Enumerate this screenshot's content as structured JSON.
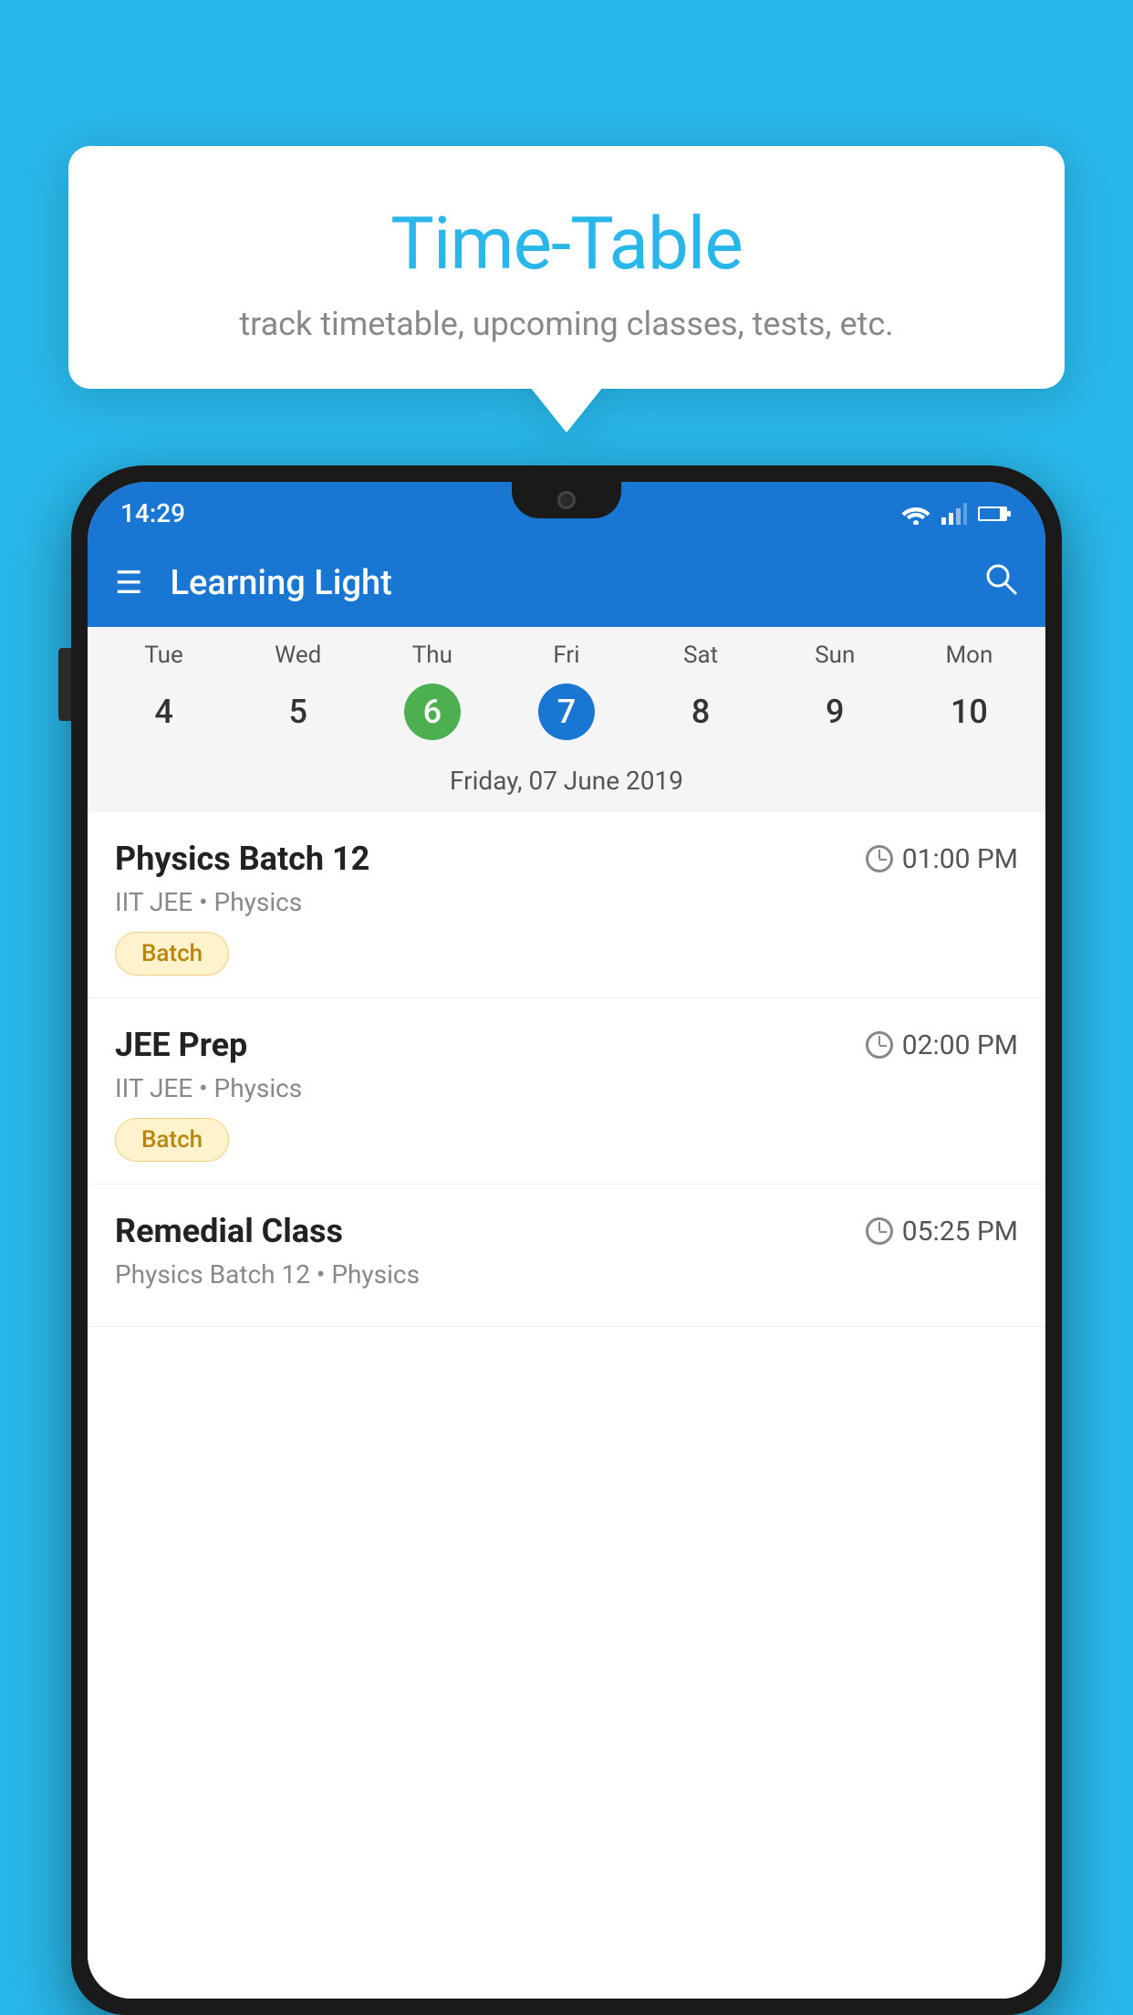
{
  "background_color": "#29B6E8",
  "tooltip": {
    "title": "Time-Table",
    "subtitle": "track timetable, upcoming classes, tests, etc."
  },
  "phone": {
    "status_bar": {
      "time": "14:29",
      "icons": [
        "wifi",
        "signal",
        "battery"
      ]
    },
    "app_bar": {
      "title": "Learning Light",
      "menu_label": "☰",
      "search_label": "🔍"
    },
    "calendar": {
      "day_headers": [
        "Tue",
        "Wed",
        "Thu",
        "Fri",
        "Sat",
        "Sun",
        "Mon"
      ],
      "day_numbers": [
        "4",
        "5",
        "6",
        "7",
        "8",
        "9",
        "10"
      ],
      "today_index": 2,
      "selected_index": 3,
      "selected_date_label": "Friday, 07 June 2019"
    },
    "schedule": [
      {
        "title": "Physics Batch 12",
        "time": "01:00 PM",
        "subtitle": "IIT JEE • Physics",
        "tag": "Batch"
      },
      {
        "title": "JEE Prep",
        "time": "02:00 PM",
        "subtitle": "IIT JEE • Physics",
        "tag": "Batch"
      },
      {
        "title": "Remedial Class",
        "time": "05:25 PM",
        "subtitle": "Physics Batch 12 • Physics",
        "tag": ""
      }
    ]
  }
}
